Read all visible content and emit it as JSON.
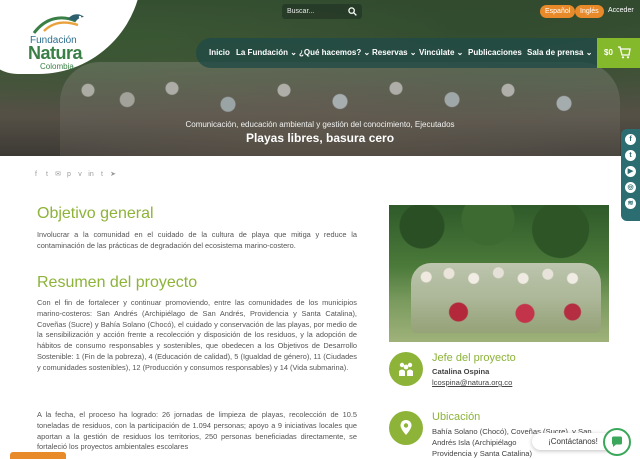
{
  "brand": {
    "line1": "Fundación",
    "line2": "Natura",
    "line3": "Colombia"
  },
  "topbar": {
    "search_placeholder": "Buscar...",
    "lang_es": "Español",
    "lang_en": "Inglés",
    "login": "Acceder"
  },
  "nav": {
    "items": [
      "Inicio",
      "La Fundación ⌄",
      "¿Qué hacemos? ⌄",
      "Reservas ⌄",
      "Vincúlate ⌄",
      "Publicaciones",
      "Sala de prensa ⌄"
    ],
    "cart_total": "$0"
  },
  "hero": {
    "categories": "Comunicación, educación ambiental y gestión del conocimiento, Ejecutados",
    "title": "Playas libres, basura cero"
  },
  "share_icons": [
    "facebook-icon",
    "twitter-icon",
    "email-icon",
    "pinterest-icon",
    "vk-icon",
    "linkedin-icon",
    "tumblr-icon",
    "telegram-icon"
  ],
  "social_icons": [
    "facebook-icon",
    "twitter-icon",
    "youtube-icon",
    "instagram-icon",
    "spotify-icon"
  ],
  "main": {
    "objective_heading": "Objetivo general",
    "objective_text": "Involucrar a la comunidad en el cuidado de la cultura de playa que mitiga y reduce la contaminación de las prácticas de degradación del ecosistema marino-costero.",
    "summary_heading": "Resumen del proyecto",
    "summary_p1": "Con el fin de fortalecer y continuar promoviendo, entre las comunidades de los municipios marino-costeros: San Andrés (Archipiélago de San Andrés, Providencia y Santa Catalina), Coveñas (Sucre) y Bahía Solano (Chocó), el cuidado y conservación de las playas, por medio de la sensibilización y acción frente a recolección y disposición de los residuos, y la adopción de hábitos de consumo responsables y sostenibles, que obedecen a los Objetivos de Desarrollo Sostenible: 1 (Fin de la pobreza), 4 (Educación de calidad), 5 (Igualdad de género), 11 (Ciudades y comunidades sostenibles), 12 (Producción y consumos responsables) y 14 (Vida submarina).",
    "summary_p2": "A la fecha, el proceso ha logrado: 26 jornadas de limpieza de playas, recolección de 10.5 toneladas de residuos, con la participación de 1.094 personas; apoyo a 9 iniciativas locales que aportan a la gestión de residuos los territorios, 250 personas beneficiadas directamente, se fortaleció los proyectos ambientales escolares"
  },
  "sidebar": {
    "chief_heading": "Jefe del proyecto",
    "chief_name": "Catalina Ospina",
    "chief_email": "lcospina@natura.org.co",
    "location_heading": "Ubicación",
    "location_l1": "Bahía Solano (Chocó), Coveñas (Sucre), y San",
    "location_l2": "Andrés Isla (Archipiélago",
    "location_l3": "Providencia y Santa Catalina)"
  },
  "chat": {
    "label": "¡Contáctanos!"
  },
  "colors": {
    "accent_green": "#8db339",
    "nav_teal": "#2c6d72",
    "lang_orange": "#e88a2a"
  }
}
